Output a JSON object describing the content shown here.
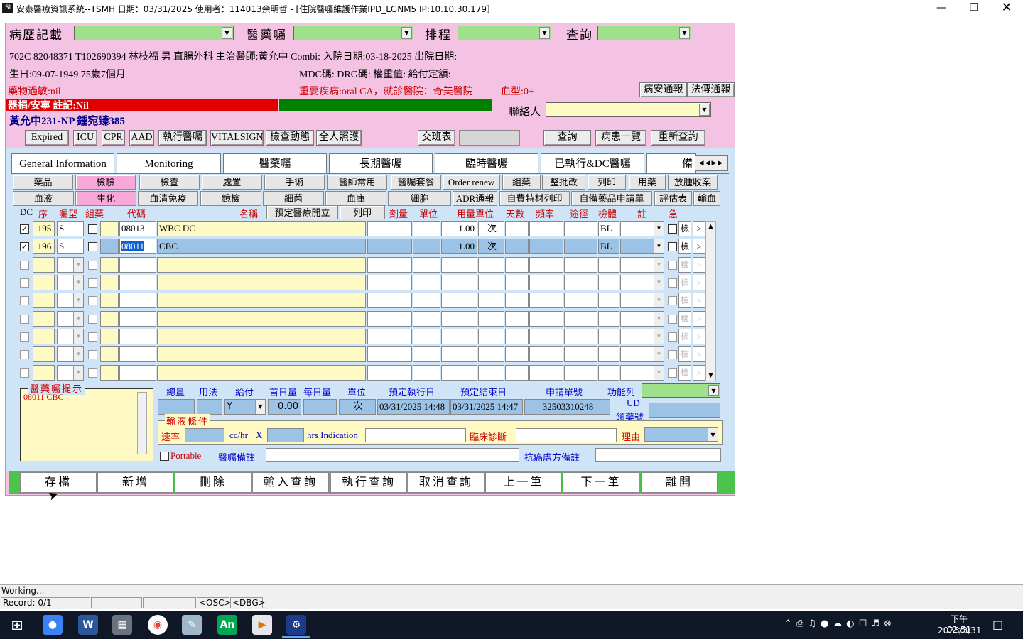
{
  "window": {
    "title": "安泰醫療資訊系統--TSMH 日期：03/31/2025 使用者：114013余明哲 - [住院醫囑維護作業IPD_LGNM5 IP:10.10.30.179]",
    "app_icon": "app-icon"
  },
  "header": {
    "record_label": "病歷記載",
    "order_label": "醫藥囑",
    "schedule_label": "排程",
    "query_label": "查詢"
  },
  "patient": {
    "line1": "702C 82048371 T102690394 林枝福 男 直腸外科 主治醫師:黃允中 Combi: 入院日期:03-18-2025 出院日期:",
    "birth": "生日:09-07-1949 75歲7個月",
    "mdc": "MDC碼:  DRG碼:  權重值:  給付定額:",
    "allergy": "藥物過敏:nil",
    "major_disease": "重要疾病:oral CA，就診醫院：奇美醫院",
    "blood_type": "血型:0+",
    "dnr": "器捐/安寧 註記:Nil",
    "doctors": "黃允中231-NP 鍾宛臻385",
    "contact_label": "聯絡人"
  },
  "top_buttons": {
    "safety_report": "病安通報",
    "infection_report": "法傳通報",
    "expired": "Expired",
    "icu": "ICU",
    "cpr": "CPR",
    "aad": "AAD",
    "exec_order": "執行醫囑",
    "vitalsign": "VITALSIGN",
    "exam_status": "檢查動態",
    "photo": "全人照護",
    "shift": "交班表",
    "query": "查詢",
    "patient_list": "病患一覽",
    "requery": "重新查詢"
  },
  "tabs": [
    "General Information",
    "Monitoring",
    "醫藥囑",
    "長期醫囑",
    "臨時醫囑",
    "已執行&DC醫囑",
    "備"
  ],
  "sub_row1": [
    "藥品",
    "檢驗",
    "檢查",
    "處置",
    "手術",
    "醫師常用",
    "醫囑套餐",
    "Order renew",
    "組藥",
    "整批改",
    "列印",
    "用藥",
    "放腫收案"
  ],
  "sub_row2": [
    "血液",
    "生化",
    "血清免疫",
    "鏡檢",
    "細菌",
    "血庫",
    "細胞",
    "ADR通報",
    "自費特材列印",
    "自備藥品申請單",
    "評估表",
    "輸血"
  ],
  "columns": {
    "dc": "DC",
    "seq": "序",
    "type": "囑型",
    "group": "組藥",
    "code": "代碼",
    "name": "名稱",
    "scheduled": "預定醫療開立",
    "print": "列印",
    "dose": "劑量",
    "unit": "單位",
    "use_unit": "用量單位",
    "days": "天數",
    "freq": "頻率",
    "route": "途徑",
    "specimen": "檢體",
    "note": "註",
    "urgent": "急"
  },
  "rows": [
    {
      "seq": "195",
      "type": "S",
      "code": "08013",
      "name": "WBC DC",
      "qty": "1.00",
      "unit": "次",
      "specimen": "BL",
      "exam": "檢",
      "more": ">"
    },
    {
      "seq": "196",
      "type": "S",
      "code": "08011",
      "name": "CBC",
      "qty": "1.00",
      "unit": "次",
      "specimen": "BL",
      "exam": "檢",
      "more": ">"
    }
  ],
  "empty_row_exam": "檢",
  "empty_row_more": ">",
  "hint": {
    "label": "醫藥囑提示",
    "text": "08011 CBC"
  },
  "detail": {
    "total_label": "總量",
    "usage_label": "用法",
    "pay_label": "給付",
    "first_label": "首日量",
    "daily_label": "每日量",
    "unit_label": "單位",
    "start_label": "預定執行日",
    "end_label": "預定結束日",
    "apply_label": "申請單號",
    "func_label": "功能列",
    "pay_value": "Y",
    "first_value": "0.00",
    "unit_value": "次",
    "start_value": "03/31/2025 14:48",
    "end_value": "03/31/2025 14:47",
    "apply_value": "32503310248",
    "ud_label": "UD",
    "ud_no_label": "領藥號"
  },
  "infusion": {
    "label": "輸液條件",
    "rate_label": "速率",
    "cchr": "cc/hr",
    "x": "X",
    "hrs_indication": "hrs Indication",
    "diagnosis_label": "臨床診斷",
    "reason_label": "理由",
    "portable": "Portable",
    "remark_label": "醫囑備註",
    "chemo_label": "抗癌處方備註"
  },
  "bottom_buttons": [
    "存檔",
    "新增",
    "刪除",
    "輸入查詢",
    "執行查詢",
    "取消查詢",
    "上一筆",
    "下一筆",
    "離開"
  ],
  "status": {
    "working": "Working...",
    "record": "Record: 0/1",
    "osc": "<OSC>",
    "dbg": "<DBG>"
  },
  "taskbar": {
    "time": "下午 02:51",
    "date": "2025/3/31"
  },
  "colors": {
    "form_bg": "#f4c3e3",
    "combo_green": "#9fe08a",
    "dnr_red": "#e00000",
    "green_bar": "#008000",
    "work_blue": "#cfe4f7",
    "input_yellow": "#fff9c4"
  }
}
